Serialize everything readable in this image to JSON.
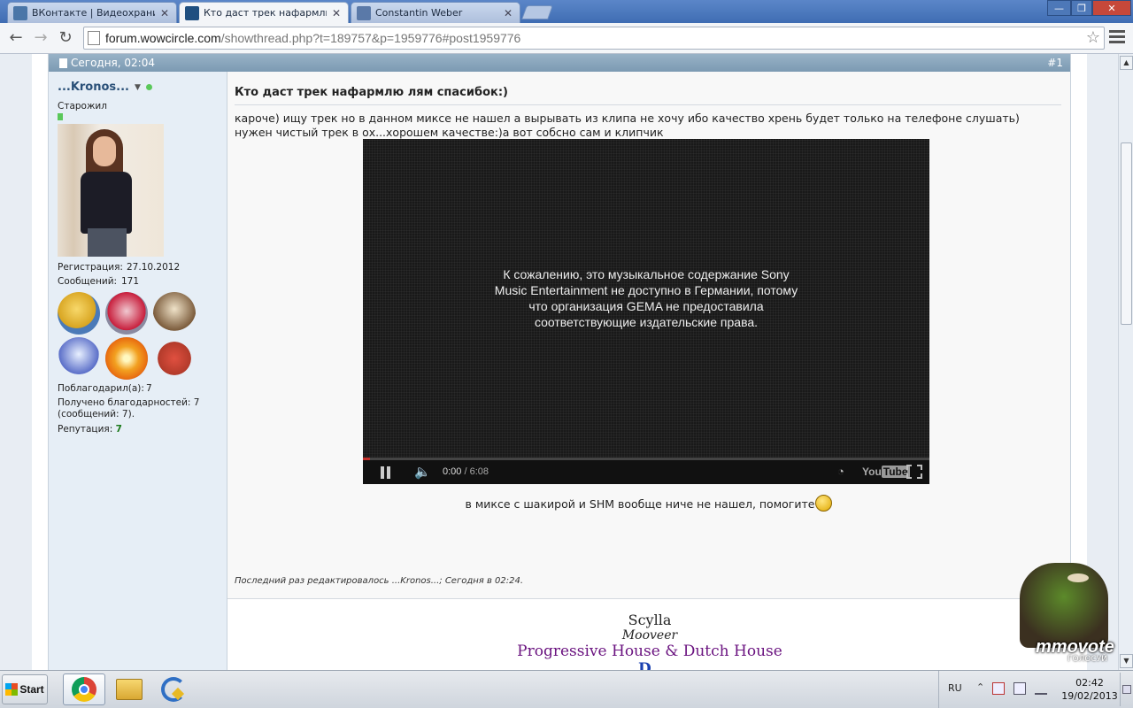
{
  "browser": {
    "tabs": [
      {
        "title": "ВКонтакте | Видеохранили",
        "close": "✕",
        "active": false,
        "icon_color": "#4a76a8"
      },
      {
        "title": "Кто даст трек нафармлю л",
        "close": "✕",
        "active": true,
        "icon_color": "#1f4f80"
      },
      {
        "title": "Constantin Weber",
        "close": "✕",
        "active": false,
        "icon_color": "#5a79a8"
      }
    ],
    "window_controls": {
      "minimize": "—",
      "maximize": "❐",
      "close": "✕"
    },
    "nav": {
      "back": "←",
      "forward": "→",
      "reload": "↻"
    },
    "url_host": "forum.wowcircle.com",
    "url_path": "/showthread.php?t=189757&p=1959776#post1959776",
    "bookmark_star": "☆"
  },
  "post": {
    "date": "Сегодня, 02:04",
    "number": "#1",
    "title": "Кто даст трек нафармлю лям спасибок:)",
    "body_line1": "кароче) ищу трек но в данном миксе не нашел а вырывать из клипа не хочу ибо качество хрень будет только на телефоне слушать)",
    "body_line2": "нужен чистый трек в ох...хорошем качестве:)а вот собсно сам и клипчик",
    "video": {
      "message_lines": [
        "К сожалению, это музыкальное содержание Sony",
        "Music Entertainment не доступно в Германии, потому",
        "что организация GEMA не предоставила",
        "соответствующие издательские права."
      ],
      "time_current": "0:00",
      "time_separator": " / ",
      "time_total": "6:08",
      "progress": 0,
      "youtube_you": "You",
      "youtube_tube": "Tube"
    },
    "after_text": "в миксе с шакирой и SHM вообще ниче не нашел, помогите",
    "edited_note": "Последний раз редактировалось ...Kronos...; Сегодня в 02:24.",
    "signature": {
      "line1": "Scylla",
      "line2": "Mooveer",
      "line3": "Progressive House & Dutch House",
      "line4": "D.."
    }
  },
  "user": {
    "name": "...Kronos...",
    "rank": "Старожил",
    "stats": [
      {
        "label": "Регистрация:",
        "value": "27.10.2012"
      },
      {
        "label": "Сообщений:",
        "value": "171"
      }
    ],
    "thanked_label": "Поблагодарил(а):",
    "thanked_value": "7",
    "received_line1": "Получено благодарностей: 7",
    "received_line2": "(сообщений: 7).",
    "reputation_label": "Репутация:",
    "reputation_value": "7",
    "award_colors": [
      "#d8a420",
      "#c81e3c",
      "#7a5a3a",
      "#5a6ec8",
      "#e86a10",
      "#b23a2a"
    ]
  },
  "widget": {
    "logo": "mmovote",
    "subtitle": "ГОЛОСУЙ"
  },
  "taskbar": {
    "start_label": "Start",
    "language": "RU",
    "tray_arrow": "⌃",
    "time": "02:42",
    "date": "19/02/2013"
  }
}
